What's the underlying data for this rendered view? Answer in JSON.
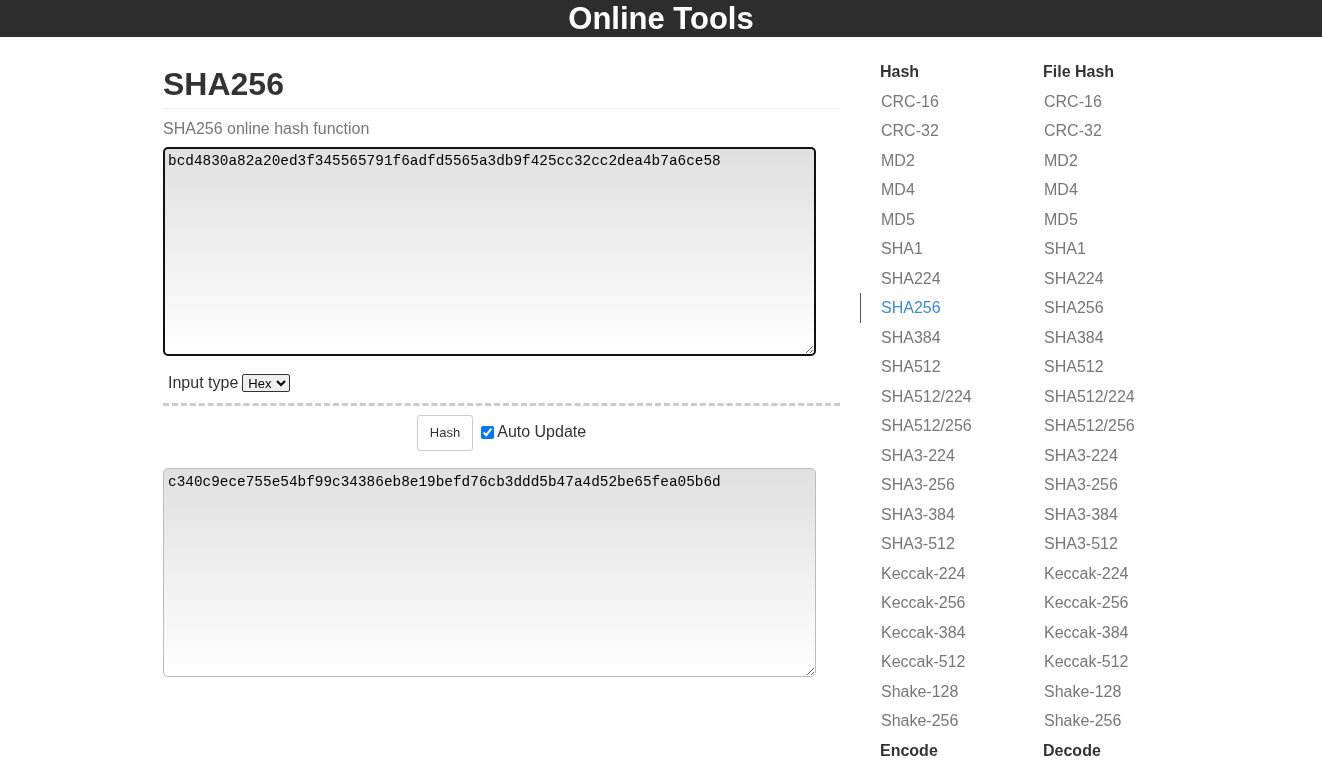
{
  "header": {
    "title": "Online Tools"
  },
  "page": {
    "title": "SHA256",
    "subtitle": "SHA256 online hash function"
  },
  "input": {
    "value": "bcd4830a82a20ed3f345565791f6adfd5565a3db9f425cc32cc2dea4b7a6ce58",
    "focused": true
  },
  "input_type": {
    "label": "Input type",
    "value": "Hex"
  },
  "hash_button": {
    "label": "Hash"
  },
  "auto_update": {
    "label": "Auto Update",
    "checked": true
  },
  "output": {
    "value": "c340c9ece755e54bf99c34386eb8e19befd76cb3ddd5b47a4d52be65fea05b6d",
    "focused": false
  },
  "sidebar": {
    "columns": [
      {
        "sections": [
          {
            "heading": "Hash",
            "items": [
              {
                "label": "CRC-16",
                "selected": false
              },
              {
                "label": "CRC-32",
                "selected": false
              },
              {
                "label": "MD2",
                "selected": false
              },
              {
                "label": "MD4",
                "selected": false
              },
              {
                "label": "MD5",
                "selected": false
              },
              {
                "label": "SHA1",
                "selected": false
              },
              {
                "label": "SHA224",
                "selected": false
              },
              {
                "label": "SHA256",
                "selected": true
              },
              {
                "label": "SHA384",
                "selected": false
              },
              {
                "label": "SHA512",
                "selected": false
              },
              {
                "label": "SHA512/224",
                "selected": false
              },
              {
                "label": "SHA512/256",
                "selected": false
              },
              {
                "label": "SHA3-224",
                "selected": false
              },
              {
                "label": "SHA3-256",
                "selected": false
              },
              {
                "label": "SHA3-384",
                "selected": false
              },
              {
                "label": "SHA3-512",
                "selected": false
              },
              {
                "label": "Keccak-224",
                "selected": false
              },
              {
                "label": "Keccak-256",
                "selected": false
              },
              {
                "label": "Keccak-384",
                "selected": false
              },
              {
                "label": "Keccak-512",
                "selected": false
              },
              {
                "label": "Shake-128",
                "selected": false
              },
              {
                "label": "Shake-256",
                "selected": false
              }
            ]
          },
          {
            "heading": "Encode"
          }
        ]
      },
      {
        "sections": [
          {
            "heading": "File Hash",
            "items": [
              {
                "label": "CRC-16",
                "selected": false
              },
              {
                "label": "CRC-32",
                "selected": false
              },
              {
                "label": "MD2",
                "selected": false
              },
              {
                "label": "MD4",
                "selected": false
              },
              {
                "label": "MD5",
                "selected": false
              },
              {
                "label": "SHA1",
                "selected": false
              },
              {
                "label": "SHA224",
                "selected": false
              },
              {
                "label": "SHA256",
                "selected": false
              },
              {
                "label": "SHA384",
                "selected": false
              },
              {
                "label": "SHA512",
                "selected": false
              },
              {
                "label": "SHA512/224",
                "selected": false
              },
              {
                "label": "SHA512/256",
                "selected": false
              },
              {
                "label": "SHA3-224",
                "selected": false
              },
              {
                "label": "SHA3-256",
                "selected": false
              },
              {
                "label": "SHA3-384",
                "selected": false
              },
              {
                "label": "SHA3-512",
                "selected": false
              },
              {
                "label": "Keccak-224",
                "selected": false
              },
              {
                "label": "Keccak-256",
                "selected": false
              },
              {
                "label": "Keccak-384",
                "selected": false
              },
              {
                "label": "Keccak-512",
                "selected": false
              },
              {
                "label": "Shake-128",
                "selected": false
              },
              {
                "label": "Shake-256",
                "selected": false
              }
            ]
          },
          {
            "heading": "Decode"
          }
        ]
      }
    ]
  }
}
